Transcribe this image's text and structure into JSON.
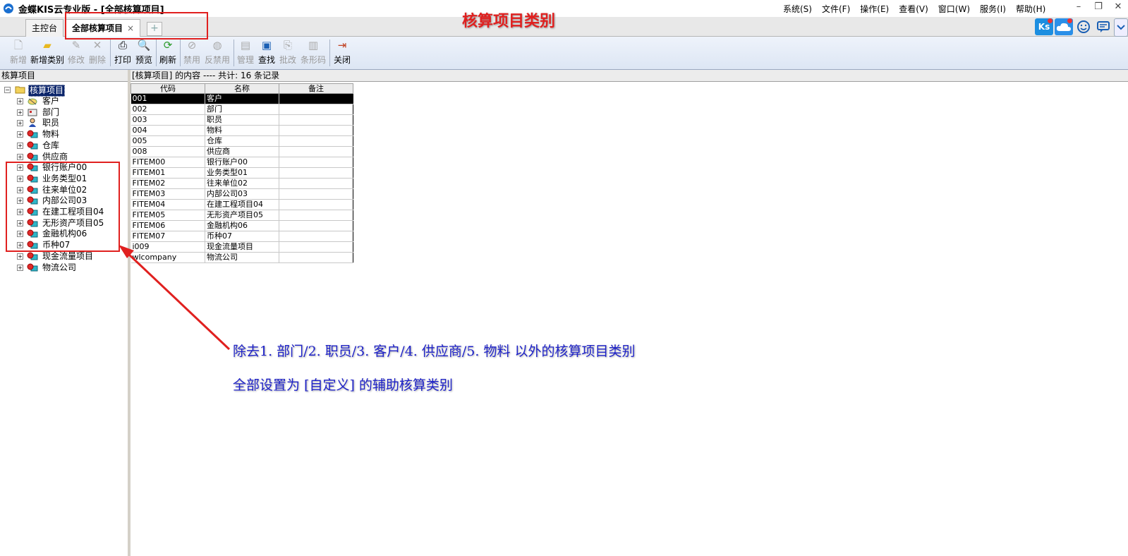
{
  "titlebar": {
    "title": "金蝶KIS云专业版 - [全部核算项目]",
    "menus": [
      "系统(S)",
      "文件(F)",
      "操作(E)",
      "查看(V)",
      "窗口(W)",
      "服务(I)",
      "帮助(H)"
    ]
  },
  "tabs": [
    {
      "label": "主控台"
    },
    {
      "label": "全部核算项目",
      "close": "×"
    }
  ],
  "addtab_label": "+",
  "right_tools": {
    "kis_label": "Ks"
  },
  "toolbar": {
    "items": [
      {
        "label": "新增",
        "icon": "page-icon",
        "enabled": false
      },
      {
        "label": "新增类别",
        "icon": "folder-icon",
        "enabled": true
      },
      {
        "label": "修改",
        "icon": "edit-icon",
        "enabled": false
      },
      {
        "label": "删除",
        "icon": "delete-icon",
        "enabled": false
      },
      {
        "label": "打印",
        "icon": "print-icon",
        "enabled": true
      },
      {
        "label": "预览",
        "icon": "preview-icon",
        "enabled": true
      },
      {
        "label": "刷新",
        "icon": "refresh-icon",
        "enabled": true
      },
      {
        "label": "禁用",
        "icon": "ban-icon",
        "enabled": false
      },
      {
        "label": "反禁用",
        "icon": "unban-icon",
        "enabled": false
      },
      {
        "label": "管理",
        "icon": "manage-icon",
        "enabled": false
      },
      {
        "label": "查找",
        "icon": "find-icon",
        "enabled": true
      },
      {
        "label": "批改",
        "icon": "batch-edit-icon",
        "enabled": false
      },
      {
        "label": "条形码",
        "icon": "barcode-icon",
        "enabled": false
      },
      {
        "label": "关闭",
        "icon": "exit-icon",
        "enabled": true
      }
    ]
  },
  "left_panel": {
    "header": "核算项目",
    "root": "核算项目",
    "nodes": [
      {
        "label": "客户",
        "icon": "customer-icon"
      },
      {
        "label": "部门",
        "icon": "department-icon"
      },
      {
        "label": "职员",
        "icon": "employee-icon"
      },
      {
        "label": "物料",
        "icon": "item-icon"
      },
      {
        "label": "仓库",
        "icon": "item-icon"
      },
      {
        "label": "供应商",
        "icon": "item-icon"
      },
      {
        "label": "银行账户00",
        "icon": "item-icon"
      },
      {
        "label": "业务类型01",
        "icon": "item-icon"
      },
      {
        "label": "往来单位02",
        "icon": "item-icon"
      },
      {
        "label": "内部公司03",
        "icon": "item-icon"
      },
      {
        "label": "在建工程项目04",
        "icon": "item-icon"
      },
      {
        "label": "无形资产项目05",
        "icon": "item-icon"
      },
      {
        "label": "金融机构06",
        "icon": "item-icon"
      },
      {
        "label": "币种07",
        "icon": "item-icon"
      },
      {
        "label": "现金流量项目",
        "icon": "item-icon"
      },
      {
        "label": "物流公司",
        "icon": "item-icon"
      }
    ]
  },
  "content": {
    "header": "[核算项目] 的内容 ---- 共计: 16 条记录",
    "columns": [
      "代码",
      "名称",
      "备注"
    ],
    "rows": [
      [
        "001",
        "客户",
        ""
      ],
      [
        "002",
        "部门",
        ""
      ],
      [
        "003",
        "职员",
        ""
      ],
      [
        "004",
        "物料",
        ""
      ],
      [
        "005",
        "仓库",
        ""
      ],
      [
        "008",
        "供应商",
        ""
      ],
      [
        "FITEM00",
        "银行账户00",
        ""
      ],
      [
        "FITEM01",
        "业务类型01",
        ""
      ],
      [
        "FITEM02",
        "往来单位02",
        ""
      ],
      [
        "FITEM03",
        "内部公司03",
        ""
      ],
      [
        "FITEM04",
        "在建工程项目04",
        ""
      ],
      [
        "FITEM05",
        "无形资产项目05",
        ""
      ],
      [
        "FITEM06",
        "金融机构06",
        ""
      ],
      [
        "FITEM07",
        "币种07",
        ""
      ],
      [
        "i009",
        "现金流量项目",
        ""
      ],
      [
        "wlcompany",
        "物流公司",
        ""
      ]
    ],
    "selected_row": 0
  },
  "annotations": {
    "title": "核算项目类别",
    "line1": "除去1. 部门/2. 职员/3. 客户/4. 供应商/5. 物料   以外的核算项目类别",
    "line2": "全部设置为 [自定义] 的辅助核算类别",
    "colors": {
      "red": "#e0201f",
      "blue": "#1e22c8"
    }
  }
}
